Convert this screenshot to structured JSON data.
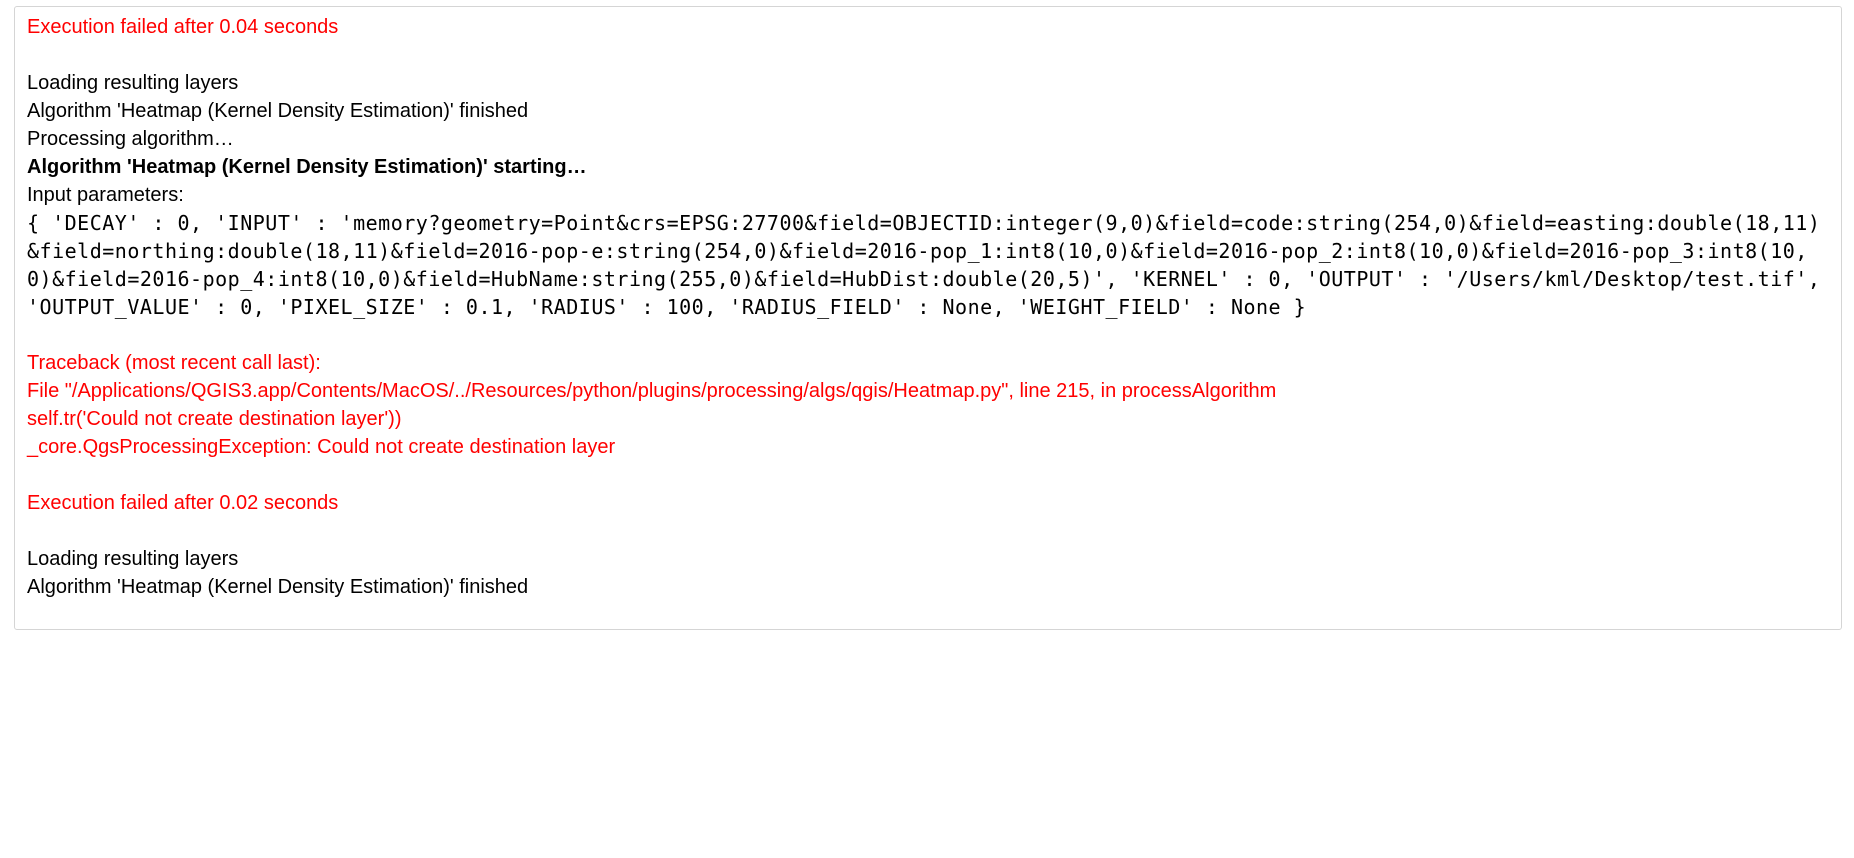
{
  "log": {
    "exec_fail_1": "Execution failed after 0.04 seconds",
    "loading_1": "Loading resulting layers",
    "alg_finished_1": "Algorithm 'Heatmap (Kernel Density Estimation)' finished",
    "processing": "Processing algorithm…",
    "alg_starting": "Algorithm 'Heatmap (Kernel Density Estimation)' starting…",
    "input_params_label": "Input parameters:",
    "params": "{ 'DECAY' : 0, 'INPUT' : 'memory?geometry=Point&crs=EPSG:27700&field=OBJECTID:integer(9,0)&field=code:string(254,0)&field=easting:double(18,11)&field=northing:double(18,11)&field=2016-pop-e:string(254,0)&field=2016-pop_1:int8(10,0)&field=2016-pop_2:int8(10,0)&field=2016-pop_3:int8(10,0)&field=2016-pop_4:int8(10,0)&field=HubName:string(255,0)&field=HubDist:double(20,5)', 'KERNEL' : 0, 'OUTPUT' : '/Users/kml/Desktop/test.tif', 'OUTPUT_VALUE' : 0, 'PIXEL_SIZE' : 0.1, 'RADIUS' : 100, 'RADIUS_FIELD' : None, 'WEIGHT_FIELD' : None }",
    "traceback_header": "Traceback (most recent call last):",
    "traceback_file": "File \"/Applications/QGIS3.app/Contents/MacOS/../Resources/python/plugins/processing/algs/qgis/Heatmap.py\", line 215, in processAlgorithm",
    "traceback_line": "self.tr('Could not create destination layer'))",
    "traceback_exc": "_core.QgsProcessingException: Could not create destination layer",
    "exec_fail_2": "Execution failed after 0.02 seconds",
    "loading_2": "Loading resulting layers",
    "alg_finished_2": "Algorithm 'Heatmap (Kernel Density Estimation)' finished"
  }
}
